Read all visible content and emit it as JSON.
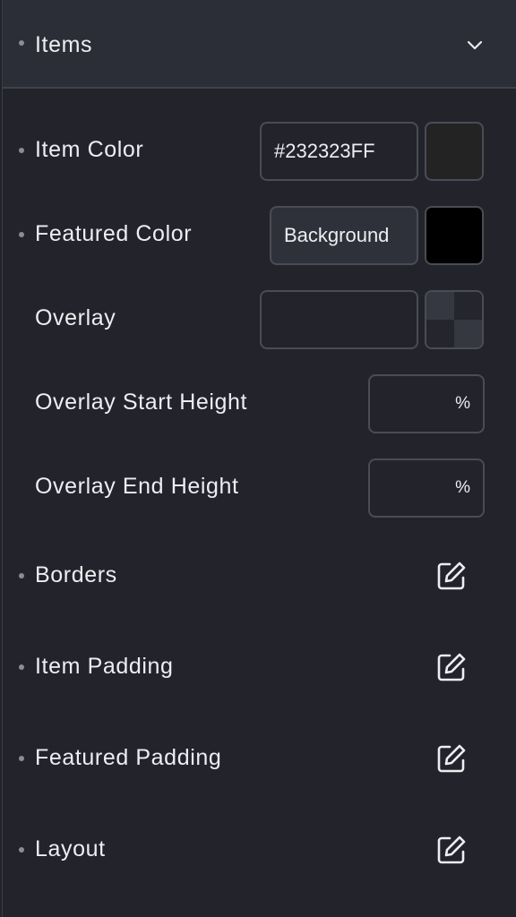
{
  "section": {
    "title": "Items",
    "toggle_icon": "chevron-down-icon"
  },
  "rows": {
    "item_color": {
      "label": "Item Color",
      "value": "#232323FF",
      "swatch": "#232323"
    },
    "featured_color": {
      "label": "Featured Color",
      "value": "Background",
      "swatch": "#000000"
    },
    "overlay": {
      "label": "Overlay",
      "value": ""
    },
    "overlay_start": {
      "label": "Overlay Start Height",
      "unit": "%"
    },
    "overlay_end": {
      "label": "Overlay End Height",
      "unit": "%"
    },
    "borders": {
      "label": "Borders",
      "icon": "edit-icon"
    },
    "item_padding": {
      "label": "Item Padding",
      "icon": "edit-icon"
    },
    "featured_padding": {
      "label": "Featured Padding",
      "icon": "edit-icon"
    },
    "layout": {
      "label": "Layout",
      "icon": "edit-icon"
    }
  },
  "colors": {
    "panel_bg": "#23242b",
    "header_bg": "#2c2e37",
    "border": "#4a4c55",
    "text": "#eceef2"
  }
}
